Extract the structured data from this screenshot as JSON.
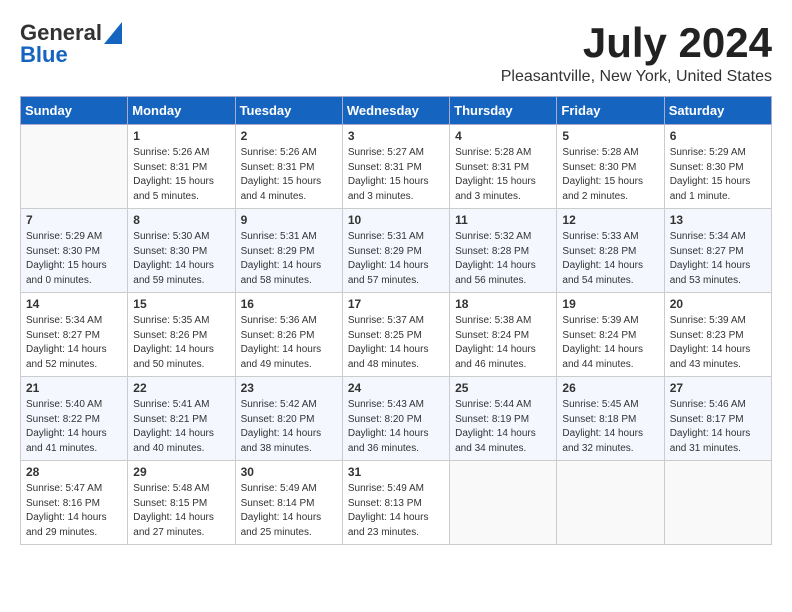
{
  "header": {
    "logo_line1": "General",
    "logo_line2": "Blue",
    "month_year": "July 2024",
    "location": "Pleasantville, New York, United States"
  },
  "days_of_week": [
    "Sunday",
    "Monday",
    "Tuesday",
    "Wednesday",
    "Thursday",
    "Friday",
    "Saturday"
  ],
  "weeks": [
    [
      {
        "day": "",
        "content": ""
      },
      {
        "day": "1",
        "content": "Sunrise: 5:26 AM\nSunset: 8:31 PM\nDaylight: 15 hours\nand 5 minutes."
      },
      {
        "day": "2",
        "content": "Sunrise: 5:26 AM\nSunset: 8:31 PM\nDaylight: 15 hours\nand 4 minutes."
      },
      {
        "day": "3",
        "content": "Sunrise: 5:27 AM\nSunset: 8:31 PM\nDaylight: 15 hours\nand 3 minutes."
      },
      {
        "day": "4",
        "content": "Sunrise: 5:28 AM\nSunset: 8:31 PM\nDaylight: 15 hours\nand 3 minutes."
      },
      {
        "day": "5",
        "content": "Sunrise: 5:28 AM\nSunset: 8:30 PM\nDaylight: 15 hours\nand 2 minutes."
      },
      {
        "day": "6",
        "content": "Sunrise: 5:29 AM\nSunset: 8:30 PM\nDaylight: 15 hours\nand 1 minute."
      }
    ],
    [
      {
        "day": "7",
        "content": "Sunrise: 5:29 AM\nSunset: 8:30 PM\nDaylight: 15 hours\nand 0 minutes."
      },
      {
        "day": "8",
        "content": "Sunrise: 5:30 AM\nSunset: 8:30 PM\nDaylight: 14 hours\nand 59 minutes."
      },
      {
        "day": "9",
        "content": "Sunrise: 5:31 AM\nSunset: 8:29 PM\nDaylight: 14 hours\nand 58 minutes."
      },
      {
        "day": "10",
        "content": "Sunrise: 5:31 AM\nSunset: 8:29 PM\nDaylight: 14 hours\nand 57 minutes."
      },
      {
        "day": "11",
        "content": "Sunrise: 5:32 AM\nSunset: 8:28 PM\nDaylight: 14 hours\nand 56 minutes."
      },
      {
        "day": "12",
        "content": "Sunrise: 5:33 AM\nSunset: 8:28 PM\nDaylight: 14 hours\nand 54 minutes."
      },
      {
        "day": "13",
        "content": "Sunrise: 5:34 AM\nSunset: 8:27 PM\nDaylight: 14 hours\nand 53 minutes."
      }
    ],
    [
      {
        "day": "14",
        "content": "Sunrise: 5:34 AM\nSunset: 8:27 PM\nDaylight: 14 hours\nand 52 minutes."
      },
      {
        "day": "15",
        "content": "Sunrise: 5:35 AM\nSunset: 8:26 PM\nDaylight: 14 hours\nand 50 minutes."
      },
      {
        "day": "16",
        "content": "Sunrise: 5:36 AM\nSunset: 8:26 PM\nDaylight: 14 hours\nand 49 minutes."
      },
      {
        "day": "17",
        "content": "Sunrise: 5:37 AM\nSunset: 8:25 PM\nDaylight: 14 hours\nand 48 minutes."
      },
      {
        "day": "18",
        "content": "Sunrise: 5:38 AM\nSunset: 8:24 PM\nDaylight: 14 hours\nand 46 minutes."
      },
      {
        "day": "19",
        "content": "Sunrise: 5:39 AM\nSunset: 8:24 PM\nDaylight: 14 hours\nand 44 minutes."
      },
      {
        "day": "20",
        "content": "Sunrise: 5:39 AM\nSunset: 8:23 PM\nDaylight: 14 hours\nand 43 minutes."
      }
    ],
    [
      {
        "day": "21",
        "content": "Sunrise: 5:40 AM\nSunset: 8:22 PM\nDaylight: 14 hours\nand 41 minutes."
      },
      {
        "day": "22",
        "content": "Sunrise: 5:41 AM\nSunset: 8:21 PM\nDaylight: 14 hours\nand 40 minutes."
      },
      {
        "day": "23",
        "content": "Sunrise: 5:42 AM\nSunset: 8:20 PM\nDaylight: 14 hours\nand 38 minutes."
      },
      {
        "day": "24",
        "content": "Sunrise: 5:43 AM\nSunset: 8:20 PM\nDaylight: 14 hours\nand 36 minutes."
      },
      {
        "day": "25",
        "content": "Sunrise: 5:44 AM\nSunset: 8:19 PM\nDaylight: 14 hours\nand 34 minutes."
      },
      {
        "day": "26",
        "content": "Sunrise: 5:45 AM\nSunset: 8:18 PM\nDaylight: 14 hours\nand 32 minutes."
      },
      {
        "day": "27",
        "content": "Sunrise: 5:46 AM\nSunset: 8:17 PM\nDaylight: 14 hours\nand 31 minutes."
      }
    ],
    [
      {
        "day": "28",
        "content": "Sunrise: 5:47 AM\nSunset: 8:16 PM\nDaylight: 14 hours\nand 29 minutes."
      },
      {
        "day": "29",
        "content": "Sunrise: 5:48 AM\nSunset: 8:15 PM\nDaylight: 14 hours\nand 27 minutes."
      },
      {
        "day": "30",
        "content": "Sunrise: 5:49 AM\nSunset: 8:14 PM\nDaylight: 14 hours\nand 25 minutes."
      },
      {
        "day": "31",
        "content": "Sunrise: 5:49 AM\nSunset: 8:13 PM\nDaylight: 14 hours\nand 23 minutes."
      },
      {
        "day": "",
        "content": ""
      },
      {
        "day": "",
        "content": ""
      },
      {
        "day": "",
        "content": ""
      }
    ]
  ]
}
